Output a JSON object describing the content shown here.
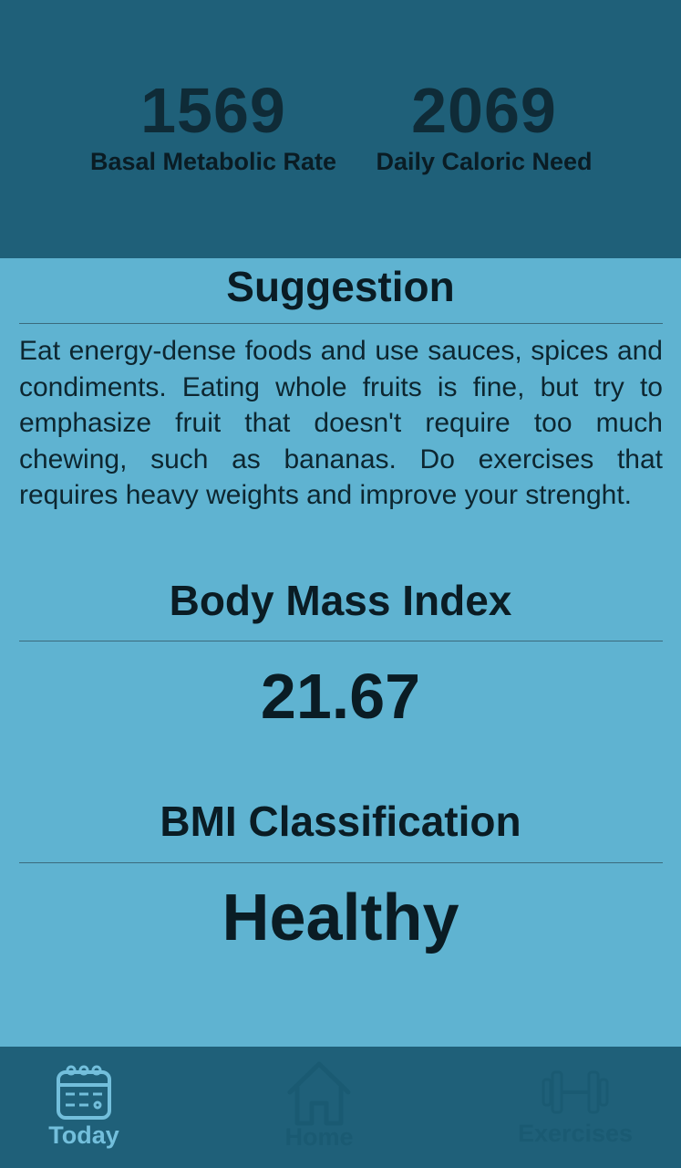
{
  "header": {
    "bmr_value": "1569",
    "bmr_label": "Basal Metabolic Rate",
    "dcn_value": "2069",
    "dcn_label": "Daily Caloric Need"
  },
  "suggestion": {
    "title": "Suggestion",
    "text": "Eat energy-dense foods and use sauces, spices and condiments. Eating whole fruits is fine, but try to emphasize fruit that doesn't require too much chewing, such as bananas. Do exercises that requires heavy weights and improve your strenght."
  },
  "bmi": {
    "title": "Body Mass Index",
    "value": "21.67"
  },
  "classification": {
    "title": "BMI Classification",
    "value": "Healthy"
  },
  "nav": {
    "items": [
      {
        "label": "Today",
        "icon": "calendar-icon",
        "active": true
      },
      {
        "label": "Home",
        "icon": "home-icon",
        "active": false
      },
      {
        "label": "Exercises",
        "icon": "dumbbell-icon",
        "active": false
      }
    ]
  },
  "colors": {
    "header_bg": "#1f6079",
    "content_bg": "#5fb3d1",
    "active_nav": "#73bfdc",
    "inactive_nav": "#1a5a72"
  }
}
